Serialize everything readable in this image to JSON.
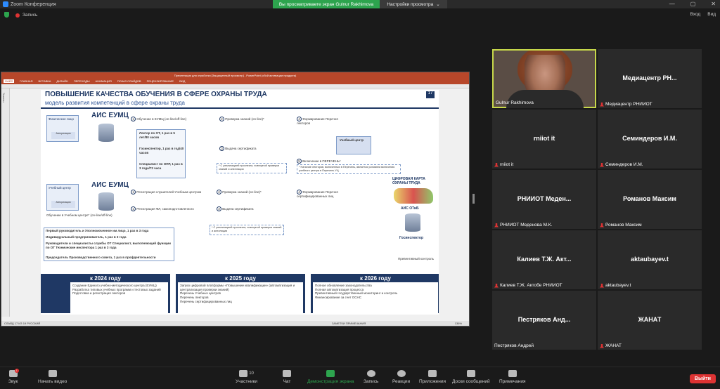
{
  "window": {
    "app_title": "Zoom Конференция",
    "min": "—",
    "max": "▢",
    "close": "✕"
  },
  "share_banner": {
    "text": "Вы просматриваете экран Gulnur Rakhimova",
    "options": "Настройки просмотра"
  },
  "topbar": {
    "recording": "Запись",
    "enter": "Вход",
    "view": "Вид"
  },
  "ppt": {
    "title": "Презентация для отработки [Защищенный просмотр] - PowerPoint (сбой активации продукта)",
    "tabs": [
      "ФАЙЛ",
      "ГЛАВНАЯ",
      "ВСТАВКА",
      "ДИЗАЙН",
      "ПЕРЕХОДЫ",
      "АНИМАЦИЯ",
      "ПОКАЗ СЛАЙДОВ",
      "РЕЦЕНЗИРОВАНИЕ",
      "ВИД"
    ],
    "status": "СЛАЙД 17 ИЗ 19   РУССКИЙ",
    "status_right": "ЗАМЕТКИ   ПРИМЕЧАНИЯ",
    "zoom": "136%",
    "side_label": "Эскизы"
  },
  "slide": {
    "title": "ПОВЫШЕНИЕ КАЧЕСТВА ОБУЧЕНИЯ В СФЕРЕ ОХРАНЫ ТРУДА",
    "subtitle": "модель развития компетенций в сфере охраны труда",
    "logo": "17",
    "row1": {
      "entity_label": "Физическое лицо",
      "entity_inner": "Авторизация",
      "system": "АИС ЕУМЦ",
      "step1": "Обучение в ЕУМЦ (on-line/off-line)",
      "items": [
        "Лектор по ОТ, 1 раз в 5 лет/80 часов",
        "Госинспектор, 1 раз в год/40 часов",
        "Специалист по ОПР, 1 раз в 3 года/72 часа"
      ],
      "step2": "Проверка знаний (on-line)*",
      "step3": "Выдача сертификата",
      "note": "* С реализацией проспекта, повторной проверки знаний и апелляции",
      "step4": "Формирование Перечня лекторов",
      "center": "Учебный центр",
      "step5": "Включение в ПЕРЕЧЕНЬ*",
      "note5": "* Наличие лекторов, включенных в Перечень, является условием включения учебного центра в Перечень УЦ"
    },
    "row2": {
      "entity_label": "Учебный центр",
      "entity_inner": "Авторизация",
      "system": "АИС ЕУМЦ",
      "caption": "Обучение в Учебном центре\" (on-line/off-line)",
      "reg1": "Регистрация слушателей Учебным центром",
      "reg2": "Регистрация ФЛ, самоподготовленного",
      "step2": "Проверка знаний (on-line)*",
      "step3": "Выдача сертификата",
      "note": "* С реализацией проспекта, повторной проверки знаний и апелляции",
      "step4": "Формирование Перечня сертифицированных лиц"
    },
    "right": {
      "map_title": "ЦИФРОВАЯ КАРТА ОХРАНЫ ТРУДА",
      "ais": "АИС ОТиБ",
      "inspector": "Госинспектор",
      "control": "Превентивный контроль"
    },
    "table": [
      "Первый руководитель и Уполномоченное им лицо, 1 раз в 3 года",
      "Индивидуальный предприниматель, 1 раз в 3 года",
      "Руководители и специалисты службы ОТ Специалист, выполняющий функции по ОТ Технические инспектора   1 раз в 3 года",
      "Председатель Производственного совета, 1 раз в профдеятельности"
    ],
    "years": [
      {
        "head": "к 2024 году",
        "lines": [
          "Создание Единого учебно-методического центра (ЕУМЦ)",
          "Разработка типовых учебных программ и тестовых заданий",
          "Подготовка и регистрация лекторов"
        ]
      },
      {
        "head": "к 2025 году",
        "lines": [
          "Запуск цифровой платформы «Повышение квалификации» (автоматизация и централизация проверки знаний)",
          "Перечень Учебных центров",
          "Перечень лекторов",
          "Перечень сертифицированных лиц"
        ]
      },
      {
        "head": "к 2026 году",
        "lines": [
          "Полное обновление законодательства",
          "Полная автоматизация процесса",
          "Превентивный государственный мониторинг и контроль",
          "Финансирование за счет ОСНС"
        ]
      }
    ]
  },
  "gallery": {
    "tiles": [
      {
        "name": "",
        "caption": "Gulnur Rakhimova",
        "video": true
      },
      {
        "name": "Медиацентр РН...",
        "caption": "Медиацентр РНИИОТ"
      },
      {
        "name": "rniiot it",
        "caption": "rniiot it"
      },
      {
        "name": "Семиндеров И.М.",
        "caption": "Семиндеров И.М."
      },
      {
        "name": "РНИИОТ Меден...",
        "caption": "РНИИОТ Меденова М.К."
      },
      {
        "name": "Романов Максим",
        "caption": "Романов Максим"
      },
      {
        "name": "Калиев Т.Ж. Акт...",
        "caption": "Калиев Т.Ж. Актобе РНИИОТ"
      },
      {
        "name": "aktaubayev.t",
        "caption": "aktaubayev.t"
      },
      {
        "name": "Пестряков Анд...",
        "caption": "Пестряков Андрей"
      },
      {
        "name": "ЖАНАТ",
        "caption": "ЖАНАТ"
      }
    ]
  },
  "toolbar": {
    "audio": "Звук",
    "video": "Начать видео",
    "participants": "Участники",
    "participants_count": "10",
    "chat": "Чат",
    "share": "Демонстрация экрана",
    "record": "Запись",
    "reactions": "Реакции",
    "apps": "Приложения",
    "whiteboard": "Доски сообщений",
    "notes": "Примечания",
    "leave": "Выйти"
  }
}
